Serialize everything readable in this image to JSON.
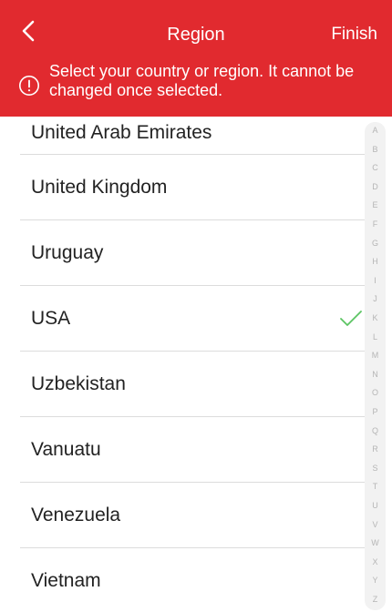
{
  "header": {
    "back_icon": "chevron-left-icon",
    "title": "Region",
    "finish_label": "Finish",
    "background_color": "#e12a2f"
  },
  "notice": {
    "icon": "exclamation-circle-icon",
    "text": "Select your country or region. It cannot be changed once selected."
  },
  "regions": [
    {
      "label": "United Arab Emirates",
      "selected": false
    },
    {
      "label": "United Kingdom",
      "selected": false
    },
    {
      "label": "Uruguay",
      "selected": false
    },
    {
      "label": "USA",
      "selected": true
    },
    {
      "label": "Uzbekistan",
      "selected": false
    },
    {
      "label": "Vanuatu",
      "selected": false
    },
    {
      "label": "Venezuela",
      "selected": false
    },
    {
      "label": "Vietnam",
      "selected": false
    }
  ],
  "selected_check_icon": "checkmark-icon",
  "check_color": "#5cc463",
  "index_letters": [
    "A",
    "B",
    "C",
    "D",
    "E",
    "F",
    "G",
    "H",
    "I",
    "J",
    "K",
    "L",
    "M",
    "N",
    "O",
    "P",
    "Q",
    "R",
    "S",
    "T",
    "U",
    "V",
    "W",
    "X",
    "Y",
    "Z"
  ]
}
